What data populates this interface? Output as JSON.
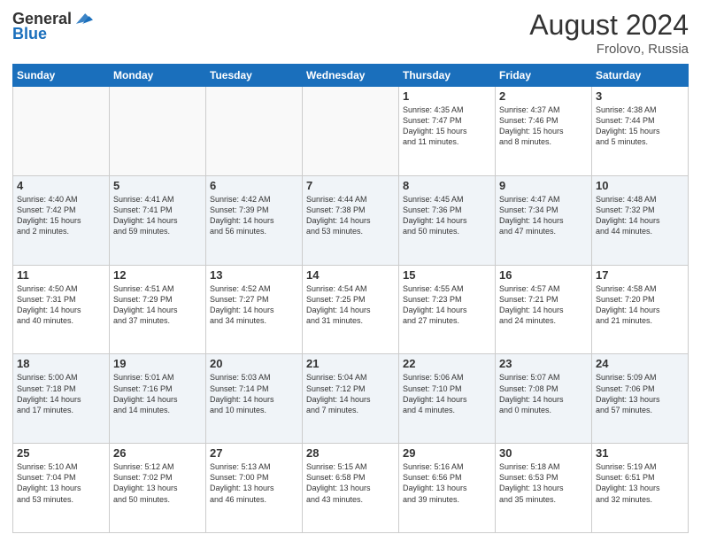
{
  "header": {
    "logo_line1": "General",
    "logo_line2": "Blue",
    "month_year": "August 2024",
    "location": "Frolovo, Russia"
  },
  "weekdays": [
    "Sunday",
    "Monday",
    "Tuesday",
    "Wednesday",
    "Thursday",
    "Friday",
    "Saturday"
  ],
  "weeks": [
    [
      {
        "day": "",
        "info": ""
      },
      {
        "day": "",
        "info": ""
      },
      {
        "day": "",
        "info": ""
      },
      {
        "day": "",
        "info": ""
      },
      {
        "day": "1",
        "info": "Sunrise: 4:35 AM\nSunset: 7:47 PM\nDaylight: 15 hours\nand 11 minutes."
      },
      {
        "day": "2",
        "info": "Sunrise: 4:37 AM\nSunset: 7:46 PM\nDaylight: 15 hours\nand 8 minutes."
      },
      {
        "day": "3",
        "info": "Sunrise: 4:38 AM\nSunset: 7:44 PM\nDaylight: 15 hours\nand 5 minutes."
      }
    ],
    [
      {
        "day": "4",
        "info": "Sunrise: 4:40 AM\nSunset: 7:42 PM\nDaylight: 15 hours\nand 2 minutes."
      },
      {
        "day": "5",
        "info": "Sunrise: 4:41 AM\nSunset: 7:41 PM\nDaylight: 14 hours\nand 59 minutes."
      },
      {
        "day": "6",
        "info": "Sunrise: 4:42 AM\nSunset: 7:39 PM\nDaylight: 14 hours\nand 56 minutes."
      },
      {
        "day": "7",
        "info": "Sunrise: 4:44 AM\nSunset: 7:38 PM\nDaylight: 14 hours\nand 53 minutes."
      },
      {
        "day": "8",
        "info": "Sunrise: 4:45 AM\nSunset: 7:36 PM\nDaylight: 14 hours\nand 50 minutes."
      },
      {
        "day": "9",
        "info": "Sunrise: 4:47 AM\nSunset: 7:34 PM\nDaylight: 14 hours\nand 47 minutes."
      },
      {
        "day": "10",
        "info": "Sunrise: 4:48 AM\nSunset: 7:32 PM\nDaylight: 14 hours\nand 44 minutes."
      }
    ],
    [
      {
        "day": "11",
        "info": "Sunrise: 4:50 AM\nSunset: 7:31 PM\nDaylight: 14 hours\nand 40 minutes."
      },
      {
        "day": "12",
        "info": "Sunrise: 4:51 AM\nSunset: 7:29 PM\nDaylight: 14 hours\nand 37 minutes."
      },
      {
        "day": "13",
        "info": "Sunrise: 4:52 AM\nSunset: 7:27 PM\nDaylight: 14 hours\nand 34 minutes."
      },
      {
        "day": "14",
        "info": "Sunrise: 4:54 AM\nSunset: 7:25 PM\nDaylight: 14 hours\nand 31 minutes."
      },
      {
        "day": "15",
        "info": "Sunrise: 4:55 AM\nSunset: 7:23 PM\nDaylight: 14 hours\nand 27 minutes."
      },
      {
        "day": "16",
        "info": "Sunrise: 4:57 AM\nSunset: 7:21 PM\nDaylight: 14 hours\nand 24 minutes."
      },
      {
        "day": "17",
        "info": "Sunrise: 4:58 AM\nSunset: 7:20 PM\nDaylight: 14 hours\nand 21 minutes."
      }
    ],
    [
      {
        "day": "18",
        "info": "Sunrise: 5:00 AM\nSunset: 7:18 PM\nDaylight: 14 hours\nand 17 minutes."
      },
      {
        "day": "19",
        "info": "Sunrise: 5:01 AM\nSunset: 7:16 PM\nDaylight: 14 hours\nand 14 minutes."
      },
      {
        "day": "20",
        "info": "Sunrise: 5:03 AM\nSunset: 7:14 PM\nDaylight: 14 hours\nand 10 minutes."
      },
      {
        "day": "21",
        "info": "Sunrise: 5:04 AM\nSunset: 7:12 PM\nDaylight: 14 hours\nand 7 minutes."
      },
      {
        "day": "22",
        "info": "Sunrise: 5:06 AM\nSunset: 7:10 PM\nDaylight: 14 hours\nand 4 minutes."
      },
      {
        "day": "23",
        "info": "Sunrise: 5:07 AM\nSunset: 7:08 PM\nDaylight: 14 hours\nand 0 minutes."
      },
      {
        "day": "24",
        "info": "Sunrise: 5:09 AM\nSunset: 7:06 PM\nDaylight: 13 hours\nand 57 minutes."
      }
    ],
    [
      {
        "day": "25",
        "info": "Sunrise: 5:10 AM\nSunset: 7:04 PM\nDaylight: 13 hours\nand 53 minutes."
      },
      {
        "day": "26",
        "info": "Sunrise: 5:12 AM\nSunset: 7:02 PM\nDaylight: 13 hours\nand 50 minutes."
      },
      {
        "day": "27",
        "info": "Sunrise: 5:13 AM\nSunset: 7:00 PM\nDaylight: 13 hours\nand 46 minutes."
      },
      {
        "day": "28",
        "info": "Sunrise: 5:15 AM\nSunset: 6:58 PM\nDaylight: 13 hours\nand 43 minutes."
      },
      {
        "day": "29",
        "info": "Sunrise: 5:16 AM\nSunset: 6:56 PM\nDaylight: 13 hours\nand 39 minutes."
      },
      {
        "day": "30",
        "info": "Sunrise: 5:18 AM\nSunset: 6:53 PM\nDaylight: 13 hours\nand 35 minutes."
      },
      {
        "day": "31",
        "info": "Sunrise: 5:19 AM\nSunset: 6:51 PM\nDaylight: 13 hours\nand 32 minutes."
      }
    ]
  ]
}
